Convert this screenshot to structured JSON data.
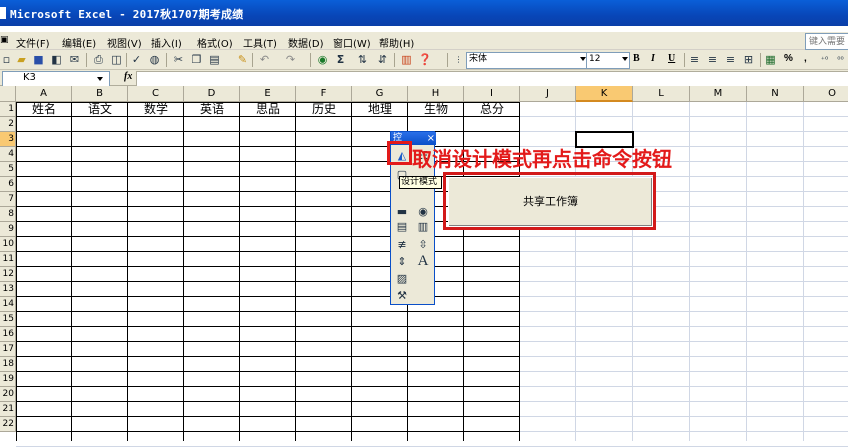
{
  "window": {
    "title": "Microsoft Excel - 2017秋1707期考成绩"
  },
  "menu": {
    "items": [
      "文件(F)",
      "编辑(E)",
      "视图(V)",
      "插入(I)",
      "格式(O)",
      "工具(T)",
      "数据(D)",
      "窗口(W)",
      "帮助(H)"
    ],
    "help_placeholder": "键入需要"
  },
  "toolbar": {
    "font_name": "宋体",
    "font_size": "12",
    "bold_label": "B",
    "italic_label": "I",
    "underline_label": "U",
    "percent_label": "%",
    "comma_label": ","
  },
  "formula_bar": {
    "name_box": "K3",
    "fx_label": "fx",
    "formula": ""
  },
  "sheet": {
    "columns": [
      "A",
      "B",
      "C",
      "D",
      "E",
      "F",
      "G",
      "H",
      "I",
      "J",
      "K",
      "L",
      "M",
      "N",
      "O"
    ],
    "active_column": "K",
    "rows": [
      "1",
      "2",
      "3",
      "4",
      "5",
      "6",
      "7",
      "8",
      "9",
      "10",
      "11",
      "12",
      "13",
      "14",
      "15",
      "16",
      "17",
      "18",
      "19",
      "20",
      "21",
      "22"
    ],
    "active_row": "3",
    "selected_cell": "K3",
    "row1_headers": [
      "姓名",
      "语文",
      "数学",
      "英语",
      "思品",
      "历史",
      "地理",
      "生物",
      "总分"
    ]
  },
  "toolbox": {
    "title": "控",
    "close_label": "×",
    "tooltip": "设计模式",
    "tools": [
      "design-mode",
      "properties",
      "view-code",
      "checkbox",
      "textbox",
      "command-button",
      "option-button",
      "listbox",
      "combobox",
      "toggle-button",
      "spin-button",
      "scrollbar",
      "label",
      "image",
      "more-controls"
    ]
  },
  "annotation": {
    "text": "取消设计模式再点击命令按钮",
    "color": "#e31a1a"
  },
  "command_button": {
    "label": "共享工作簿"
  },
  "colors": {
    "title_bar": "#0846b8",
    "chrome": "#ece9d8",
    "active_header": "#f9c972",
    "highlight_red": "#e31a1a"
  }
}
